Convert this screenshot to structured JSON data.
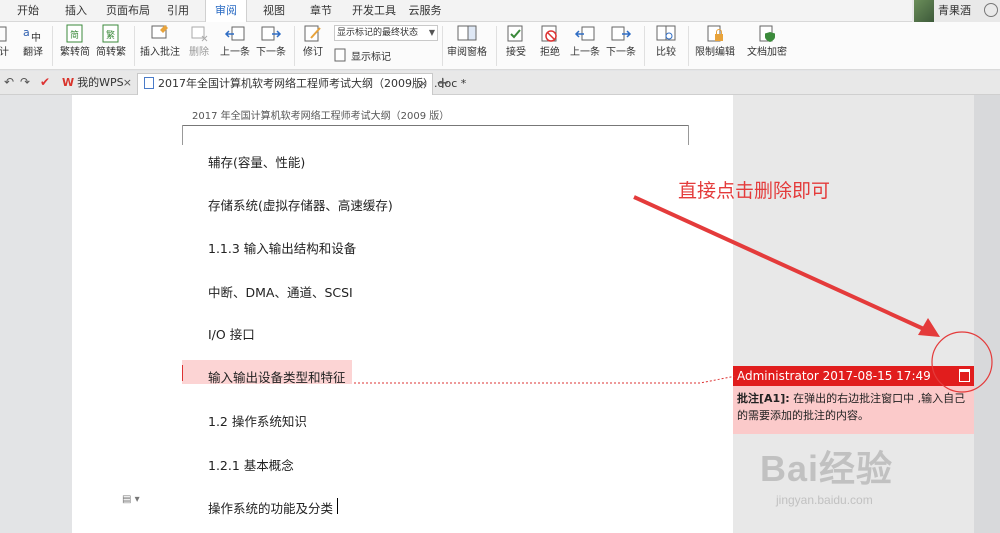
{
  "menu": {
    "tabs": [
      "开始",
      "插入",
      "页面布局",
      "引用",
      "审阅",
      "视图",
      "章节",
      "开发工具",
      "云服务"
    ],
    "active": "审阅",
    "user_name": "青果酒"
  },
  "ribbon": {
    "partial_left": "计",
    "translate": "翻译",
    "trad_simplified": "繁转简",
    "simplified_trad": "简转繁",
    "insert_comment": "插入批注",
    "delete": "删除",
    "prev_1": "上一条",
    "next_1": "下一条",
    "revise": "修订",
    "show_state": "显示标记的最终状态",
    "show_marks": "显示标记",
    "review_pane": "审阅窗格",
    "accept": "接受",
    "reject": "拒绝",
    "prev_2": "上一条",
    "next_2": "下一条",
    "compare": "比较",
    "restrict_edit": "限制编辑",
    "doc_encrypt": "文档加密"
  },
  "tabsbar": {
    "mywps": "我的WPS",
    "doc_title": "2017年全国计算机软考网络工程师考试大纲（2009版）.doc *"
  },
  "document": {
    "header": "2017 年全国计算机软考网络工程师考试大纲（2009 版）",
    "paragraphs": [
      "辅存(容量、性能)",
      "存储系统(虚拟存储器、高速缓存)",
      "1.1.3 输入输出结构和设备",
      "中断、DMA、通道、SCSI",
      "I/O 接口",
      "输入输出设备类型和特征",
      "1.2 操作系统知识",
      "1.2.1 基本概念",
      "操作系统的功能及分类"
    ]
  },
  "comment": {
    "author_time": "Administrator 2017-08-15 17:49",
    "label": "批注[A1]:",
    "text": " 在弹出的右边批注窗口中 ,输入自己的需要添加的批注的内容。"
  },
  "annotation": "直接点击删除即可",
  "watermark": {
    "main": "Bai经验",
    "url": "jingyan.baidu.com"
  },
  "colors": {
    "accent_red": "#e11d1d",
    "highlight": "#fcd4d4",
    "comment_body": "#fbcaca",
    "active_tab": "#2b6cc4"
  }
}
